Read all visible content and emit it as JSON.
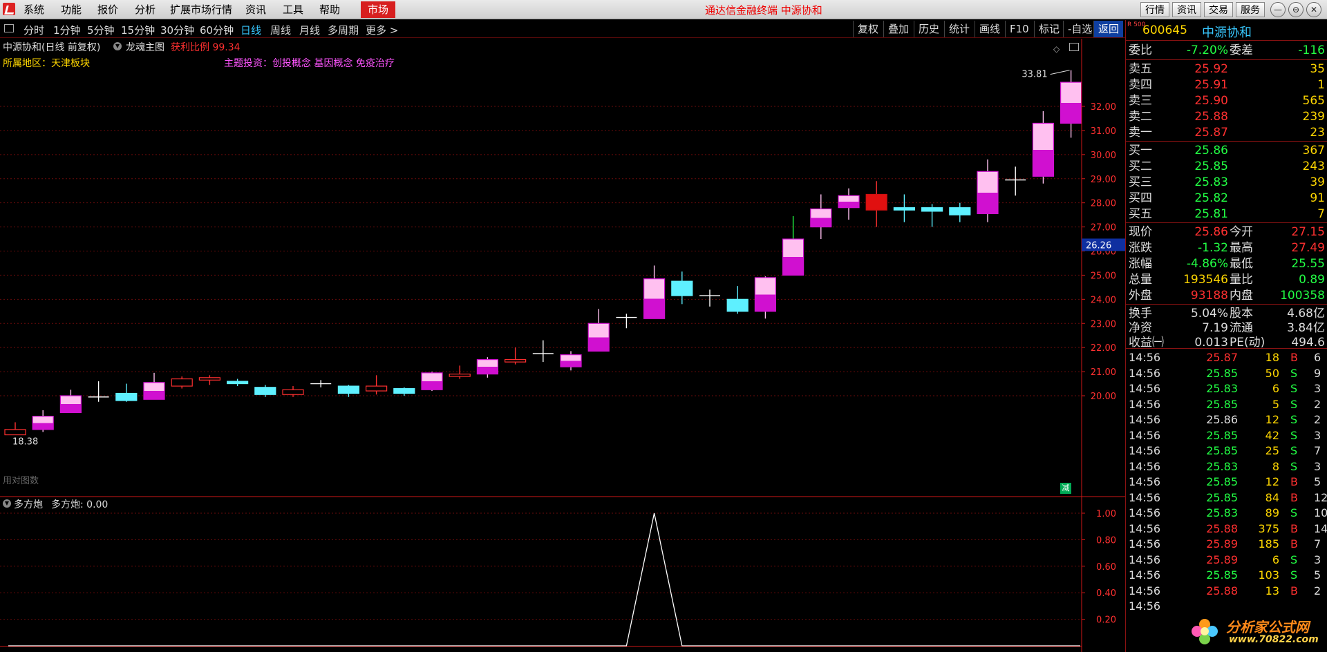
{
  "menu": {
    "items": [
      "系统",
      "功能",
      "报价",
      "分析",
      "扩展市场行情",
      "资讯",
      "工具",
      "帮助"
    ],
    "market_button": "市场",
    "app_title": "通达信金融终端 中源协和",
    "right_buttons": [
      "行情",
      "资讯",
      "交易",
      "服务"
    ],
    "window_controls": [
      "—",
      "⊖",
      "⊡",
      "✕"
    ]
  },
  "toolbar": {
    "periods": [
      "分时",
      "1分钟",
      "5分钟",
      "15分钟",
      "30分钟",
      "60分钟",
      "日线",
      "周线",
      "月线",
      "多周期",
      "更多 >"
    ],
    "active_period": "日线",
    "right_items": [
      "复权",
      "叠加",
      "历史",
      "统计",
      "画线",
      "F10",
      "标记",
      "-自选",
      "返回"
    ],
    "active_right": "返回"
  },
  "main_chart": {
    "header": "中源协和(日线 前复权)",
    "indicator": "龙魂主图",
    "profit_label": "获利比例",
    "profit_value": "99.34",
    "region_label": "所属地区：",
    "region_value": "天津板块",
    "theme_label": "主题投资：",
    "theme_value": "创投概念 基因概念 免疫治疗",
    "high_marker": "33.81",
    "low_marker": "18.38",
    "low_overlay_text": "用对图数",
    "current_price_tag": "26.26",
    "minus_label": "减"
  },
  "sub_chart": {
    "indicator": "多方炮",
    "label": "多方炮:",
    "value": "0.00"
  },
  "chart_data": [
    {
      "type": "candlestick",
      "title": "中源协和(日线 前复权)",
      "ylim": [
        18.0,
        33.5
      ],
      "y_ticks": [
        20.0,
        21.0,
        22.0,
        23.0,
        24.0,
        25.0,
        26.0,
        27.0,
        28.0,
        29.0,
        30.0,
        31.0,
        32.0
      ],
      "candles": [
        {
          "o": 18.38,
          "h": 18.9,
          "l": 18.38,
          "c": 18.6
        },
        {
          "o": 18.6,
          "h": 19.4,
          "l": 18.5,
          "c": 19.15
        },
        {
          "o": 19.3,
          "h": 20.25,
          "l": 19.3,
          "c": 20.0
        },
        {
          "o": 19.9,
          "h": 20.6,
          "l": 19.75,
          "c": 19.95
        },
        {
          "o": 20.1,
          "h": 20.5,
          "l": 19.75,
          "c": 19.8
        },
        {
          "o": 19.85,
          "h": 20.95,
          "l": 19.85,
          "c": 20.55
        },
        {
          "o": 20.4,
          "h": 20.8,
          "l": 20.3,
          "c": 20.7
        },
        {
          "o": 20.65,
          "h": 20.85,
          "l": 20.45,
          "c": 20.75
        },
        {
          "o": 20.6,
          "h": 20.7,
          "l": 20.4,
          "c": 20.5
        },
        {
          "o": 20.35,
          "h": 20.45,
          "l": 19.95,
          "c": 20.05
        },
        {
          "o": 20.05,
          "h": 20.4,
          "l": 19.95,
          "c": 20.25
        },
        {
          "o": 20.5,
          "h": 20.65,
          "l": 20.35,
          "c": 20.5
        },
        {
          "o": 20.4,
          "h": 20.45,
          "l": 19.95,
          "c": 20.1
        },
        {
          "o": 20.2,
          "h": 20.85,
          "l": 20.05,
          "c": 20.4
        },
        {
          "o": 20.3,
          "h": 20.35,
          "l": 20.0,
          "c": 20.1
        },
        {
          "o": 20.25,
          "h": 21.0,
          "l": 20.2,
          "c": 20.95
        },
        {
          "o": 20.8,
          "h": 21.25,
          "l": 20.7,
          "c": 20.9
        },
        {
          "o": 20.9,
          "h": 21.6,
          "l": 20.75,
          "c": 21.5
        },
        {
          "o": 21.4,
          "h": 22.0,
          "l": 21.3,
          "c": 21.5
        },
        {
          "o": 21.75,
          "h": 22.3,
          "l": 21.4,
          "c": 21.75
        },
        {
          "o": 21.2,
          "h": 21.85,
          "l": 21.05,
          "c": 21.7
        },
        {
          "o": 21.85,
          "h": 23.6,
          "l": 21.85,
          "c": 23.0
        },
        {
          "o": 23.2,
          "h": 23.4,
          "l": 22.8,
          "c": 23.25
        },
        {
          "o": 23.2,
          "h": 25.4,
          "l": 23.2,
          "c": 24.85
        },
        {
          "o": 24.75,
          "h": 25.15,
          "l": 23.8,
          "c": 24.15
        },
        {
          "o": 24.15,
          "h": 24.4,
          "l": 23.7,
          "c": 24.1
        },
        {
          "o": 24.0,
          "h": 24.55,
          "l": 23.4,
          "c": 23.5
        },
        {
          "o": 23.5,
          "h": 24.95,
          "l": 23.2,
          "c": 24.9
        },
        {
          "o": 25.0,
          "h": 27.45,
          "l": 25.0,
          "c": 26.5
        },
        {
          "o": 27.0,
          "h": 28.35,
          "l": 26.5,
          "c": 27.75
        },
        {
          "o": 27.8,
          "h": 28.6,
          "l": 27.3,
          "c": 28.3
        },
        {
          "o": 28.35,
          "h": 28.9,
          "l": 27.0,
          "c": 27.7
        },
        {
          "o": 27.8,
          "h": 28.35,
          "l": 27.2,
          "c": 27.7
        },
        {
          "o": 27.8,
          "h": 27.95,
          "l": 27.0,
          "c": 27.65
        },
        {
          "o": 27.8,
          "h": 28.0,
          "l": 27.2,
          "c": 27.5
        },
        {
          "o": 27.55,
          "h": 29.8,
          "l": 27.2,
          "c": 29.3
        },
        {
          "o": 28.95,
          "h": 29.5,
          "l": 28.3,
          "c": 28.9
        },
        {
          "o": 29.1,
          "h": 31.8,
          "l": 28.8,
          "c": 31.3
        },
        {
          "o": 31.3,
          "h": 33.5,
          "l": 30.7,
          "c": 33.0
        }
      ]
    },
    {
      "type": "line",
      "title": "多方炮",
      "ylim": [
        0,
        1.0
      ],
      "y_ticks": [
        0.2,
        0.4,
        0.6,
        0.8,
        1.0
      ],
      "series": [
        {
          "name": "多方炮",
          "values": [
            0,
            0,
            0,
            0,
            0,
            0,
            0,
            0,
            0,
            0,
            0,
            0,
            0,
            0,
            0,
            0,
            0,
            0,
            0,
            0,
            0,
            0,
            0,
            1,
            0,
            0,
            0,
            0,
            0,
            0,
            0,
            0,
            0,
            0,
            0,
            0,
            0,
            0,
            0
          ]
        }
      ]
    }
  ],
  "quote": {
    "code": "600645",
    "name": "中源协和",
    "tag": "R 500",
    "weibi": {
      "label": "委比",
      "value": "-7.20%",
      "label2": "委差",
      "value2": "-116"
    },
    "sell": [
      {
        "label": "卖五",
        "price": "25.92",
        "qty": "35"
      },
      {
        "label": "卖四",
        "price": "25.91",
        "qty": "1"
      },
      {
        "label": "卖三",
        "price": "25.90",
        "qty": "565"
      },
      {
        "label": "卖二",
        "price": "25.88",
        "qty": "239"
      },
      {
        "label": "卖一",
        "price": "25.87",
        "qty": "23"
      }
    ],
    "buy": [
      {
        "label": "买一",
        "price": "25.86",
        "qty": "367"
      },
      {
        "label": "买二",
        "price": "25.85",
        "qty": "243"
      },
      {
        "label": "买三",
        "price": "25.83",
        "qty": "39"
      },
      {
        "label": "买四",
        "price": "25.82",
        "qty": "91"
      },
      {
        "label": "买五",
        "price": "25.81",
        "qty": "7"
      }
    ],
    "stats": [
      {
        "label": "现价",
        "value": "25.86",
        "c1": "up",
        "label2": "今开",
        "value2": "27.15",
        "c2": "up"
      },
      {
        "label": "涨跌",
        "value": "-1.32",
        "c1": "down",
        "label2": "最高",
        "value2": "27.49",
        "c2": "up"
      },
      {
        "label": "涨幅",
        "value": "-4.86%",
        "c1": "down",
        "label2": "最低",
        "value2": "25.55",
        "c2": "down"
      },
      {
        "label": "总量",
        "value": "193546",
        "c1": "yel",
        "label2": "量比",
        "value2": "0.89",
        "c2": "down"
      },
      {
        "label": "外盘",
        "value": "93188",
        "c1": "up",
        "label2": "内盘",
        "value2": "100358",
        "c2": "down"
      }
    ],
    "finance": [
      {
        "label": "换手",
        "value": "5.04%",
        "label2": "股本",
        "value2": "4.68亿"
      },
      {
        "label": "净资",
        "value": "7.19",
        "label2": "流通",
        "value2": "3.84亿"
      },
      {
        "label": "收益㈠",
        "value": "0.013",
        "label2": "PE(动)",
        "value2": "494.6"
      }
    ],
    "ticks": [
      {
        "t": "14:56",
        "p": "25.87",
        "v": "18",
        "d": "B",
        "n": "6"
      },
      {
        "t": "14:56",
        "p": "25.85",
        "v": "50",
        "d": "S",
        "n": "9"
      },
      {
        "t": "14:56",
        "p": "25.83",
        "v": "6",
        "d": "S",
        "n": "3"
      },
      {
        "t": "14:56",
        "p": "25.85",
        "v": "5",
        "d": "S",
        "n": "2"
      },
      {
        "t": "14:56",
        "p": "25.86",
        "v": "12",
        "d": "S",
        "n": "2"
      },
      {
        "t": "14:56",
        "p": "25.85",
        "v": "42",
        "d": "S",
        "n": "3"
      },
      {
        "t": "14:56",
        "p": "25.85",
        "v": "25",
        "d": "S",
        "n": "7"
      },
      {
        "t": "14:56",
        "p": "25.83",
        "v": "8",
        "d": "S",
        "n": "3"
      },
      {
        "t": "14:56",
        "p": "25.85",
        "v": "12",
        "d": "B",
        "n": "5"
      },
      {
        "t": "14:56",
        "p": "25.85",
        "v": "84",
        "d": "B",
        "n": "12"
      },
      {
        "t": "14:56",
        "p": "25.83",
        "v": "89",
        "d": "S",
        "n": "10"
      },
      {
        "t": "14:56",
        "p": "25.88",
        "v": "375",
        "d": "B",
        "n": "14"
      },
      {
        "t": "14:56",
        "p": "25.89",
        "v": "185",
        "d": "B",
        "n": "7"
      },
      {
        "t": "14:56",
        "p": "25.89",
        "v": "6",
        "d": "S",
        "n": "3"
      },
      {
        "t": "14:56",
        "p": "25.85",
        "v": "103",
        "d": "S",
        "n": "5"
      },
      {
        "t": "14:56",
        "p": "25.88",
        "v": "13",
        "d": "B",
        "n": "2"
      },
      {
        "t": "14:56",
        "p": "",
        "v": "",
        "d": "",
        "n": ""
      }
    ]
  },
  "brand": {
    "name": "分析家公式网",
    "url": "www.70822.com"
  },
  "colors": {
    "up": "#ff3030",
    "down": "#22ff44",
    "yang_candle_top": "#ffc0f0",
    "yang_candle_bottom": "#d010d0",
    "yin_candle": "#5ef0ff",
    "grid": "#6a0b0b",
    "axis": "#d01818",
    "menu_accent": "#d71f1f",
    "link_blue": "#38c8ff"
  }
}
